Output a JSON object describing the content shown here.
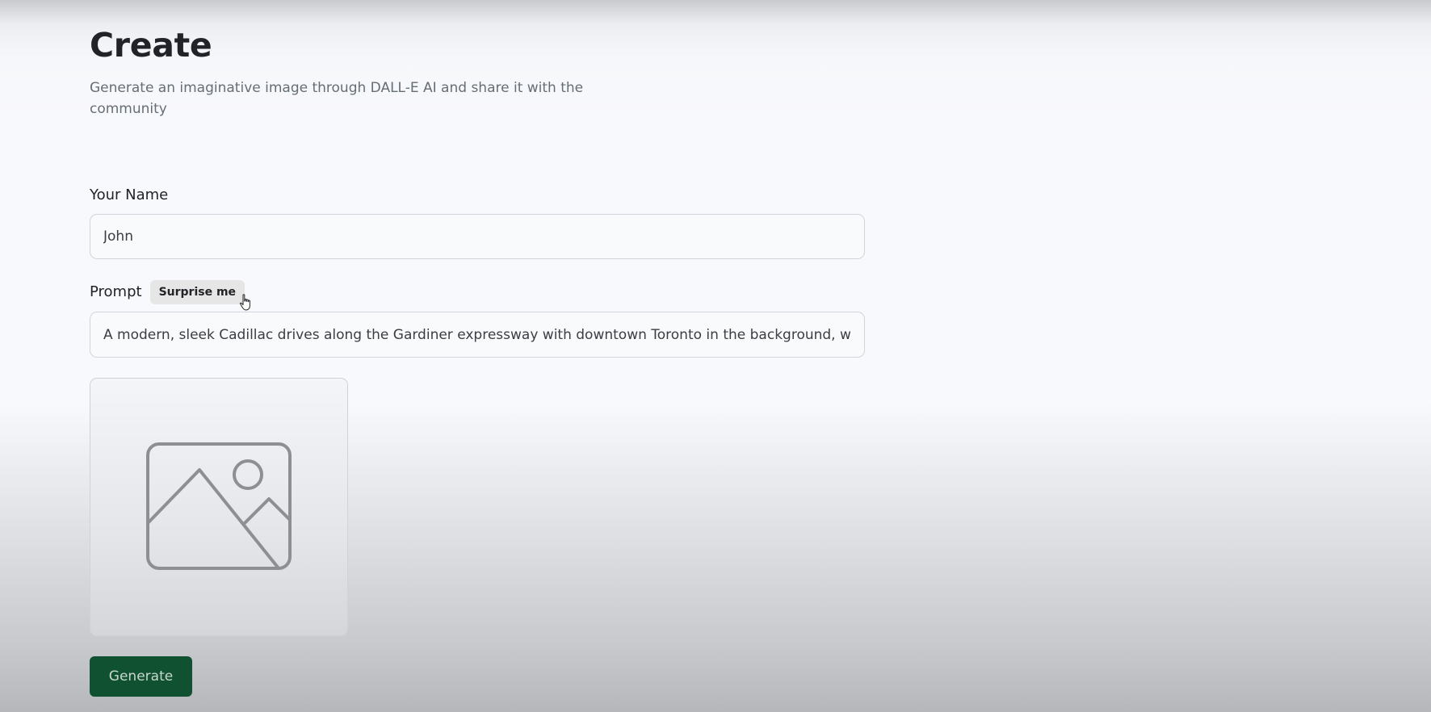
{
  "header": {
    "title": "Create",
    "subtitle": "Generate an imaginative image through DALL-E AI and share it with the community"
  },
  "form": {
    "name_label": "Your Name",
    "name_value": "John",
    "prompt_label": "Prompt",
    "surprise_label": "Surprise me",
    "prompt_value": "A modern, sleek Cadillac drives along the Gardiner expressway with downtown Toronto in the background, with a"
  },
  "preview": {
    "icon": "image-placeholder-icon"
  },
  "actions": {
    "generate_label": "Generate"
  },
  "colors": {
    "primary_button": "#0f5131",
    "title": "#222328",
    "subtitle": "#666e75"
  }
}
